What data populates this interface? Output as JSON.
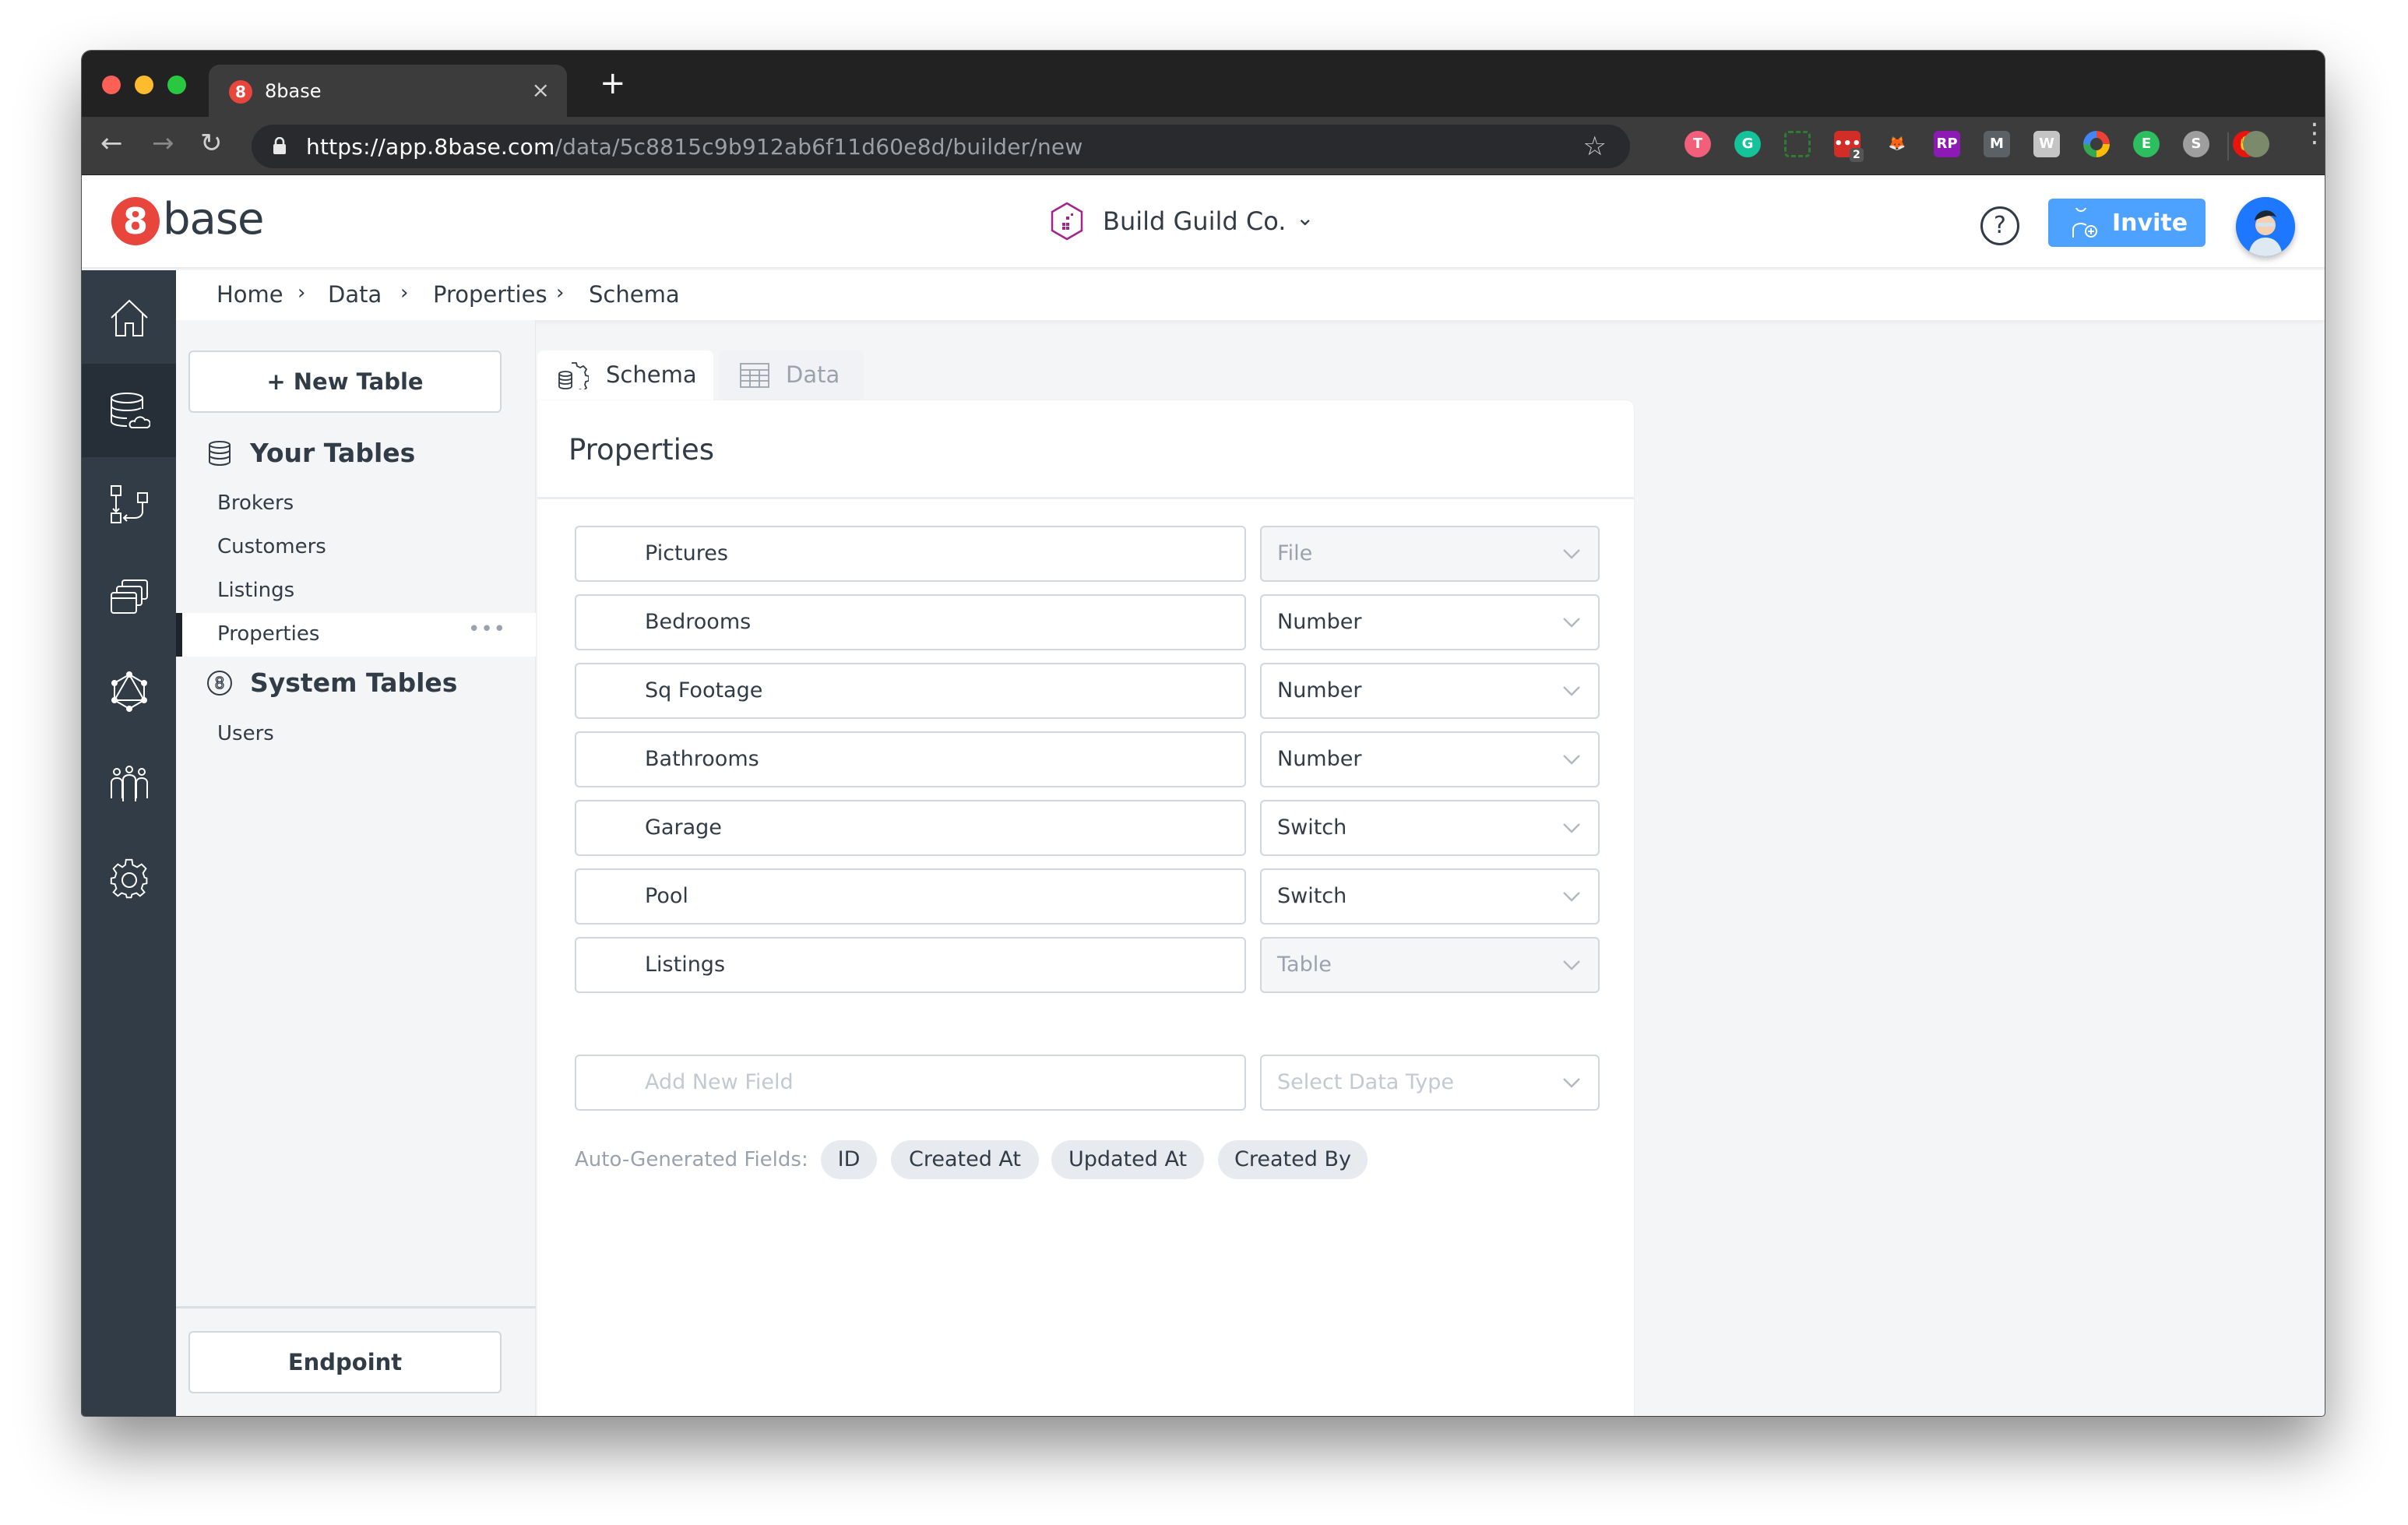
{
  "browser": {
    "tab_title": "8base",
    "tab_favicon": "8",
    "tab_close": "×",
    "new_tab": "+",
    "url_host": "https://app.8base.com",
    "url_path": "/data/5c8815c9b912ab6f11d60e8d/builder/new",
    "nav": {
      "back": "←",
      "forward": "→",
      "reload": "↻"
    },
    "star": "☆",
    "extensions": [
      {
        "name": "todoist-extension",
        "glyph": "T",
        "color": "#f25f7a",
        "round": true
      },
      {
        "name": "grammarly-extension",
        "glyph": "G",
        "color": "#15c39a",
        "round": true
      },
      {
        "name": "screenshot-extension",
        "glyph": "",
        "color": "#2d6a2d",
        "round": false
      },
      {
        "name": "lastpass-extension",
        "glyph": "•••",
        "color": "#d32d27",
        "round": false,
        "badge": "2"
      },
      {
        "name": "metamask-extension",
        "glyph": "🦊",
        "color": "transparent",
        "round": false
      },
      {
        "name": "rp-extension",
        "glyph": "RP",
        "color": "#8e1ab5",
        "round": false
      },
      {
        "name": "m-extension",
        "glyph": "M",
        "color": "#5c6166",
        "round": false
      },
      {
        "name": "w-extension",
        "glyph": "W",
        "color": "#c4c4c4",
        "round": false
      },
      {
        "name": "color-wheel-extension",
        "glyph": "",
        "color": "#ea4335",
        "round": true
      },
      {
        "name": "evernote-extension",
        "glyph": "E",
        "color": "#2dbe60",
        "round": true
      },
      {
        "name": "s-extension",
        "glyph": "S",
        "color": "#9e9e9e",
        "round": true
      },
      {
        "name": "adblock-extension",
        "glyph": "✋",
        "color": "#e8150f",
        "round": true
      }
    ],
    "menu": "⋮"
  },
  "header": {
    "logo_mark": "8",
    "logo_text": "base",
    "workspace_name": "Build Guild Co.",
    "workspace_chevron": "⌄",
    "help": "?",
    "invite_label": "Invite"
  },
  "breadcrumb": [
    {
      "label": "Home"
    },
    {
      "label": "Data"
    },
    {
      "label": "Properties"
    },
    {
      "label": "Schema"
    }
  ],
  "breadcrumb_separator": "›",
  "rail": {
    "items": [
      {
        "name": "home",
        "active": false
      },
      {
        "name": "data",
        "active": true
      },
      {
        "name": "logic",
        "active": false
      },
      {
        "name": "app-services",
        "active": false
      },
      {
        "name": "graphql",
        "active": false
      },
      {
        "name": "team",
        "active": false
      },
      {
        "name": "settings",
        "active": false
      }
    ]
  },
  "sidebar": {
    "new_table_label": "+ New Table",
    "your_tables_title": "Your Tables",
    "your_tables": [
      {
        "label": "Brokers",
        "active": false
      },
      {
        "label": "Customers",
        "active": false
      },
      {
        "label": "Listings",
        "active": false
      },
      {
        "label": "Properties",
        "active": true
      }
    ],
    "more": "•••",
    "system_tables_title": "System Tables",
    "system_tables": [
      {
        "label": "Users"
      }
    ],
    "endpoint_label": "Endpoint"
  },
  "tabs": [
    {
      "label": "Schema",
      "active": true
    },
    {
      "label": "Data",
      "active": false
    }
  ],
  "table": {
    "title": "Properties",
    "fields": [
      {
        "name": "Pictures",
        "type": "File",
        "type_disabled": true
      },
      {
        "name": "Bedrooms",
        "type": "Number",
        "type_disabled": false
      },
      {
        "name": "Sq Footage",
        "type": "Number",
        "type_disabled": false
      },
      {
        "name": "Bathrooms",
        "type": "Number",
        "type_disabled": false
      },
      {
        "name": "Garage",
        "type": "Switch",
        "type_disabled": false
      },
      {
        "name": "Pool",
        "type": "Switch",
        "type_disabled": false
      },
      {
        "name": "Listings",
        "type": "Table",
        "type_disabled": true
      }
    ],
    "new_field": {
      "name_placeholder": "Add New Field",
      "type_placeholder": "Select Data Type"
    },
    "auto_generated_label": "Auto-Generated Fields:",
    "auto_generated": [
      "ID",
      "Created At",
      "Updated At",
      "Created By"
    ]
  },
  "colors": {
    "brand_red": "#e8453c",
    "invite_blue": "#4da1ff",
    "rail_dark": "#323c47",
    "rail_active": "#262e37",
    "text": "#323c47",
    "muted": "#9aa3ad"
  }
}
